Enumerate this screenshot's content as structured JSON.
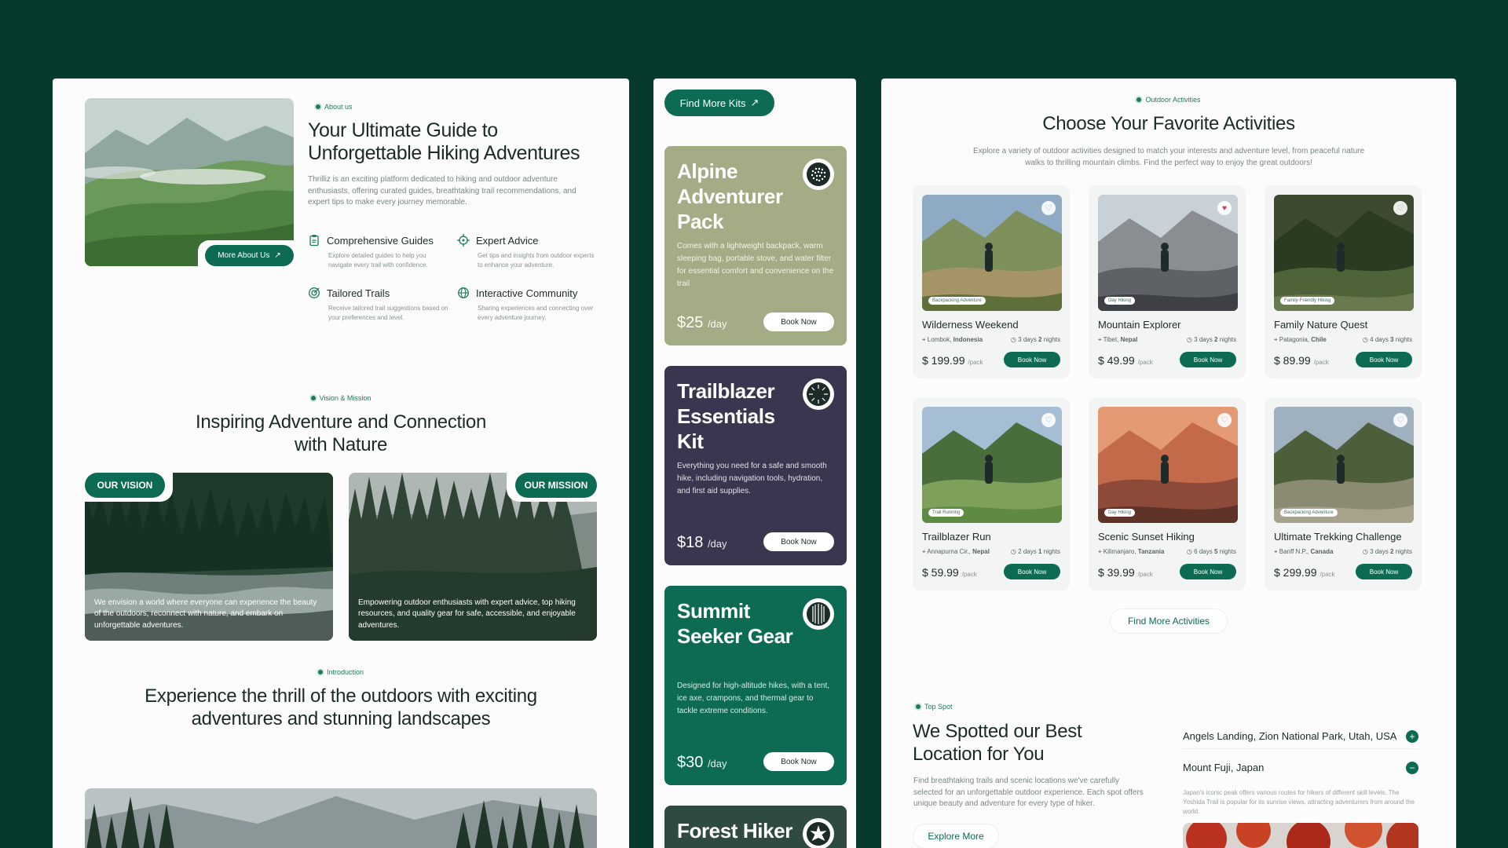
{
  "about": {
    "eyebrow": "About us",
    "title_line1": "Your Ultimate Guide to",
    "title_line2": "Unforgettable Hiking Adventures",
    "description": "Thrilliz is an exciting platform dedicated to hiking and outdoor adventure enthusiasts, offering curated guides, breathtaking trail recommendations, and expert tips to make every journey memorable.",
    "button": "More About Us",
    "features": [
      {
        "icon": "clipboard-icon",
        "title": "Comprehensive Guides",
        "desc": "Explore detailed guides to help you navigate every trail with confidence."
      },
      {
        "icon": "compass-icon",
        "title": "Expert Advice",
        "desc": "Get tips and insights from outdoor experts to enhance your adventure."
      },
      {
        "icon": "target-icon",
        "title": "Tailored Trails",
        "desc": "Receive tailored trail suggestions based on your preferences and level."
      },
      {
        "icon": "globe-icon",
        "title": "Interactive Community",
        "desc": "Sharing experiences and connecting over every adventure journey."
      }
    ]
  },
  "vision": {
    "eyebrow": "Vision & Mission",
    "title_line1": "Inspiring Adventure and Connection",
    "title_line2": "with Nature",
    "vision_label": "OUR VISION",
    "vision_text": "We envision a world where everyone can experience the beauty of the outdoors, reconnect with nature, and embark on unforgettable adventures.",
    "mission_label": "OUR MISSION",
    "mission_text": "Empowering outdoor enthusiasts with expert advice, top hiking resources, and quality gear for safe, accessible, and enjoyable adventures."
  },
  "intro": {
    "eyebrow": "Introduction",
    "title_line1": "Experience the thrill of the outdoors with exciting",
    "title_line2": "adventures and stunning landscapes"
  },
  "kits": {
    "button": "Find More Kits",
    "items": [
      {
        "title": "Alpine Adventurer Pack",
        "desc": "Comes with a lightweight backpack, warm sleeping bag, portable stove, and water filter for essential comfort and convenience on the trail",
        "price": "$25",
        "unit": "/day",
        "button": "Book Now",
        "color": "#a3ac85"
      },
      {
        "title": "Trailblazer Essentials Kit",
        "desc": "Everything you need for a safe and smooth hike, including navigation tools, hydration, and first aid supplies.",
        "price": "$18",
        "unit": "/day",
        "button": "Book Now",
        "color": "#3a3650"
      },
      {
        "title": "Summit Seeker Gear",
        "desc": "Designed for high-altitude hikes, with a tent, ice axe, crampons, and thermal gear to tackle extreme conditions.",
        "price": "$30",
        "unit": "/day",
        "button": "Book Now",
        "color": "#0c6b52"
      },
      {
        "title": "Forest Hiker",
        "color": "#2f4a3e"
      }
    ]
  },
  "activities": {
    "eyebrow": "Outdoor Activities",
    "title": "Choose Your Favorite Activities",
    "description": "Explore a variety of outdoor activities designed to match your interests and adventure level, from peaceful nature walks to thrilling mountain climbs. Find the perfect way to enjoy the great outdoors!",
    "more_button": "Find More Activities",
    "cards": [
      {
        "name": "Wilderness Weekend",
        "tag": "Backpacking Adventure",
        "loc_a": "Lombok,",
        "loc_b": "Indonesia",
        "days": "3",
        "nights": "2",
        "price": "$ 199.99",
        "unit": "/pack",
        "button": "Book Now",
        "liked": false
      },
      {
        "name": "Mountain Explorer",
        "tag": "Day Hiking",
        "loc_a": "Tibet,",
        "loc_b": "Nepal",
        "days": "3",
        "nights": "2",
        "price": "$ 49.99",
        "unit": "/pack",
        "button": "Book Now",
        "liked": true
      },
      {
        "name": "Family Nature Quest",
        "tag": "Family-Friendly Hiking",
        "loc_a": "Patagonia,",
        "loc_b": "Chile",
        "days": "4",
        "nights": "3",
        "price": "$ 89.99",
        "unit": "/pack",
        "button": "Book Now",
        "liked": false
      },
      {
        "name": "Trailblazer Run",
        "tag": "Trail Running",
        "loc_a": "Annapurna Cir.,",
        "loc_b": "Nepal",
        "days": "2",
        "nights": "1",
        "price": "$ 59.99",
        "unit": "/pack",
        "button": "Book Now",
        "liked": false
      },
      {
        "name": "Scenic Sunset Hiking",
        "tag": "Day Hiking",
        "loc_a": "Kilimanjaro,",
        "loc_b": "Tanzania",
        "days": "6",
        "nights": "5",
        "price": "$ 39.99",
        "unit": "/pack",
        "button": "Book Now",
        "liked": false
      },
      {
        "name": "Ultimate Trekking Challenge",
        "tag": "Backpacking Adventure",
        "loc_a": "Banff N.P.,",
        "loc_b": "Canada",
        "days": "3",
        "nights": "2",
        "price": "$ 299.99",
        "unit": "/pack",
        "button": "Book Now",
        "liked": false
      }
    ]
  },
  "spot": {
    "eyebrow": "Top Spot",
    "title_line1": "We Spotted our Best",
    "title_line2": "Location for You",
    "description": "Find breathtaking trails and scenic locations we've carefully selected for an unforgettable outdoor experience. Each spot offers unique beauty and adventure for every type of hiker.",
    "button": "Explore More",
    "locations": [
      {
        "name": "Angels Landing, Zion National Park, Utah, USA",
        "symbol": "+"
      },
      {
        "name": "Mount Fuji, Japan",
        "symbol": "−",
        "desc": "Japan's iconic peak offers various routes for hikers of different skill levels. The Yoshida Trail is popular for its sunrise views, attracting adventurers from around the world."
      }
    ]
  },
  "labels": {
    "days": "days",
    "nights": "nights"
  }
}
